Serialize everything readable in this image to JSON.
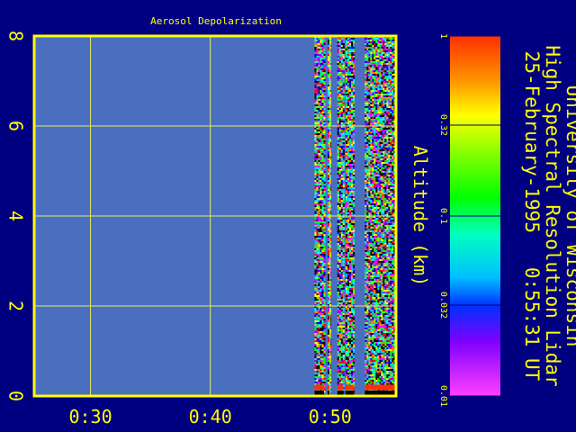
{
  "chart_data": {
    "type": "heatmap",
    "title": "Aerosol Depolarization",
    "ylabel": "Altitude (km)",
    "y_ticks": [
      "0",
      "2",
      "4",
      "6",
      "8"
    ],
    "x_ticks": [
      "0:30",
      "0:40",
      "0:50"
    ],
    "ylim": [
      0,
      8
    ],
    "x_tick_positions_min": [
      30,
      40,
      50
    ],
    "xlim_min": [
      25.3,
      55.5
    ],
    "grid": true,
    "colorbar": {
      "scale": "log",
      "range": [
        0.01,
        1
      ],
      "tick_labels": [
        "1",
        "0.32",
        "0.1",
        "0.032",
        "0.01"
      ],
      "tick_values": [
        1,
        0.32,
        0.1,
        0.032,
        0.01
      ]
    },
    "data_segments_min": [
      [
        48.7,
        49.5
      ],
      [
        49.8,
        50.0
      ],
      [
        50.6,
        51.1
      ],
      [
        51.3,
        52.0
      ],
      [
        52.9,
        55.5
      ]
    ],
    "side_title": {
      "line1": "University of Wisconsin",
      "line2": "High Spectral Resolution Lidar",
      "line3": "25-February-1995   0:55:31 UT"
    }
  },
  "colors": {
    "background": "#000080",
    "plot_fill": "#4a6fbf",
    "axis_frame": "#ffff00",
    "grid": "#e8e860"
  }
}
